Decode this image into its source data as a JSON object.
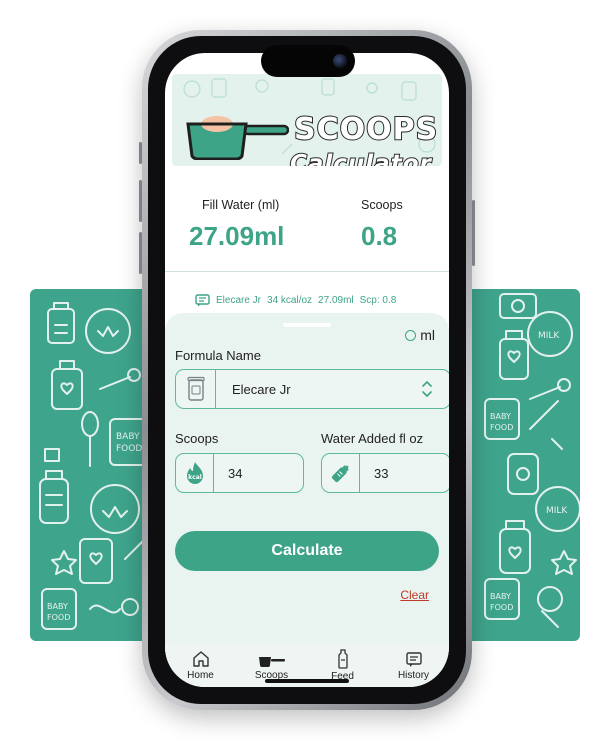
{
  "app": {
    "title_line1": "SCOOPS",
    "title_line2": "Calculator"
  },
  "results": {
    "fill_water_label": "Fill Water (ml)",
    "fill_water_value": "27.09ml",
    "scoops_label": "Scoops",
    "scoops_value": "0.8"
  },
  "summary": {
    "formula": "Elecare Jr",
    "kcal": "34 kcal/oz",
    "water": "27.09ml",
    "scoops": "Scp: 0.8"
  },
  "form": {
    "unit_label": "ml",
    "formula_name_label": "Formula Name",
    "formula_name_value": "Elecare Jr",
    "scoops_label": "Scoops",
    "scoops_value": "34",
    "water_label": "Water Added fl oz",
    "water_value": "33",
    "kcal_badge": "kcal",
    "calculate_label": "Calculate",
    "clear_label": "Clear"
  },
  "tabs": [
    {
      "label": "Home",
      "icon": "home-icon"
    },
    {
      "label": "Scoops",
      "icon": "scoop-icon"
    },
    {
      "label": "Feed",
      "icon": "bottle-icon"
    },
    {
      "label": "History",
      "icon": "history-icon"
    }
  ],
  "colors": {
    "accent": "#3da488",
    "pattern_bg": "#3fa48c",
    "clear_link": "#c0392b"
  }
}
